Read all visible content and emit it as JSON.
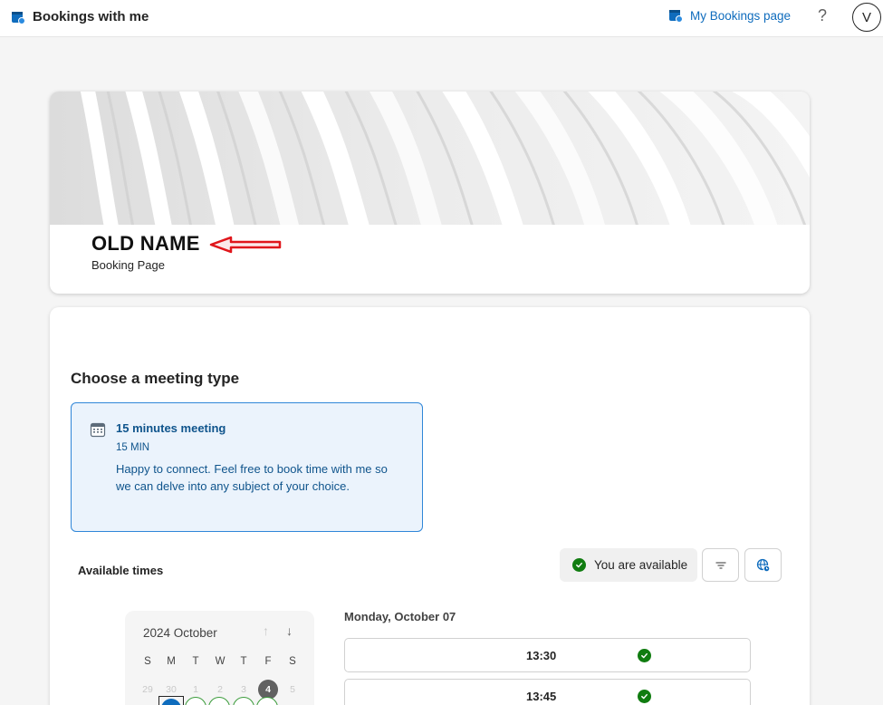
{
  "app": {
    "title": "Bookings with me"
  },
  "header": {
    "my_bookings_label": "My Bookings page",
    "help_label": "?",
    "avatar_initial": "V"
  },
  "booking_page": {
    "name": "OLD NAME",
    "subtitle": "Booking Page"
  },
  "meeting_section": {
    "title": "Choose a meeting type",
    "meeting": {
      "title": "15 minutes meeting",
      "duration": "15 MIN",
      "description": "Happy to connect. Feel free to book time with me so we can delve into any subject of your choice."
    }
  },
  "availability": {
    "label": "Available times",
    "status": "You are available"
  },
  "calendar": {
    "month_label": "2024 October",
    "weekdays": [
      "S",
      "M",
      "T",
      "W",
      "T",
      "F",
      "S"
    ],
    "first_row": [
      "29",
      "30",
      "1",
      "2",
      "3",
      "4",
      "5"
    ],
    "today": "4"
  },
  "slots": {
    "day_heading": "Monday, October 07",
    "times": [
      "13:30",
      "13:45"
    ]
  },
  "colors": {
    "accent": "#0f6cbd",
    "available_green": "#107c10",
    "meeting_card_bg": "#ebf3fc",
    "annotation_red": "#e0161b"
  }
}
